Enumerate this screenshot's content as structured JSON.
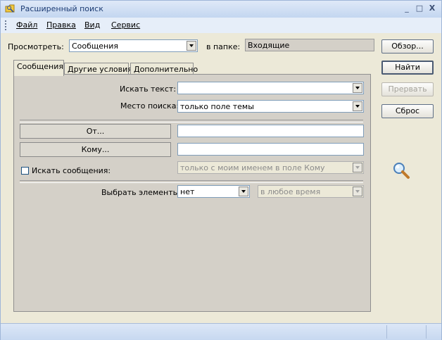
{
  "window": {
    "title": "Расширенный поиск",
    "controls": {
      "minimize": "_",
      "maximize": "□",
      "close": "X"
    }
  },
  "menu": {
    "items": [
      "Файл",
      "Правка",
      "Вид",
      "Сервис"
    ]
  },
  "top": {
    "look_in_label": "Просмотреть:",
    "look_in_value": "Сообщения",
    "folder_label": "в папке:",
    "folder_value": "Входящие"
  },
  "buttons": {
    "browse": "Обзор...",
    "find": "Найти",
    "stop": "Прервать",
    "reset": "Сброс"
  },
  "tabs": [
    {
      "label": "Сообщения",
      "active": true
    },
    {
      "label": "Другие условия",
      "active": false
    },
    {
      "label": "Дополнительно",
      "active": false
    }
  ],
  "form": {
    "search_text_label": "Искать текст:",
    "search_text_value": "",
    "search_in_label": "Место поиска:",
    "search_in_value": "только поле темы",
    "from_button": "От...",
    "from_value": "",
    "to_button": "Кому...",
    "to_value": "",
    "messages_checkbox_label": "Искать сообщения:",
    "messages_checkbox_checked": false,
    "messages_option": "только с моим именем в поле Кому",
    "time_label": "Выбрать элементы:",
    "time_value": "нет",
    "time_range": "в любое время"
  },
  "icons": {
    "search_graphic": "magnifier-icon",
    "title": "search-folder-icon"
  },
  "colors": {
    "titlebar": "#c3d6f0",
    "title_text": "#1c3b73",
    "panel": "#d4d0c8"
  }
}
